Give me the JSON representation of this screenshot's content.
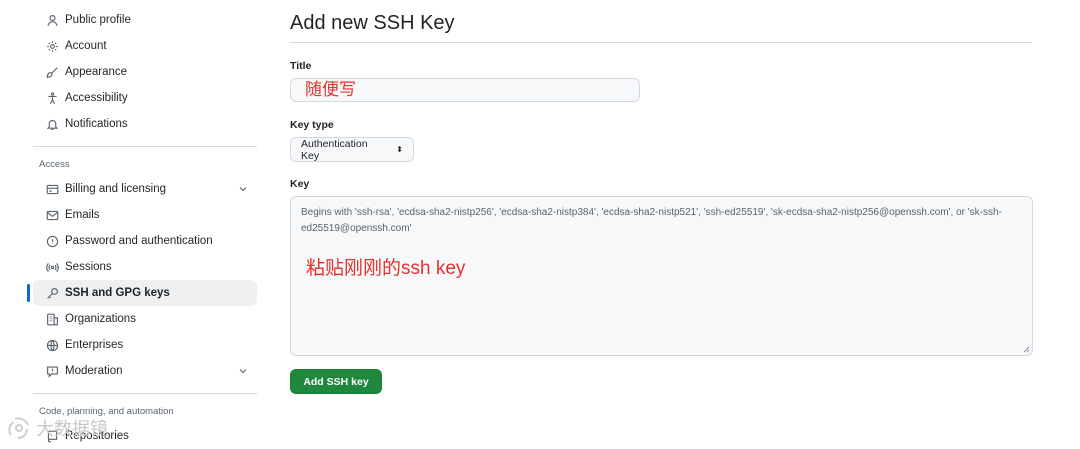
{
  "sidebar": {
    "items_top": [
      {
        "label": "Public profile",
        "icon": "person-icon"
      },
      {
        "label": "Account",
        "icon": "gear-icon"
      },
      {
        "label": "Appearance",
        "icon": "paintbrush-icon"
      },
      {
        "label": "Accessibility",
        "icon": "accessibility-icon"
      },
      {
        "label": "Notifications",
        "icon": "bell-icon"
      }
    ],
    "access_label": "Access",
    "items_access": [
      {
        "label": "Billing and licensing",
        "icon": "credit-card-icon"
      },
      {
        "label": "Emails",
        "icon": "mail-icon"
      },
      {
        "label": "Password and authentication",
        "icon": "shield-lock-icon"
      },
      {
        "label": "Sessions",
        "icon": "broadcast-icon"
      },
      {
        "label": "SSH and GPG keys",
        "icon": "key-icon"
      },
      {
        "label": "Organizations",
        "icon": "organization-icon"
      },
      {
        "label": "Enterprises",
        "icon": "globe-icon"
      },
      {
        "label": "Moderation",
        "icon": "report-icon"
      }
    ],
    "code_label": "Code, planning, and automation",
    "items_code": [
      {
        "label": "Repositories",
        "icon": "repo-icon"
      }
    ]
  },
  "main": {
    "page_title": "Add new SSH Key",
    "title_label": "Title",
    "title_value": "随便写",
    "keytype_label": "Key type",
    "keytype_selected": "Authentication Key",
    "key_label": "Key",
    "key_placeholder": "Begins with 'ssh-rsa', 'ecdsa-sha2-nistp256', 'ecdsa-sha2-nistp384', 'ecdsa-sha2-nistp521', 'ssh-ed25519', 'sk-ecdsa-sha2-nistp256@openssh.com', or 'sk-ssh-ed25519@openssh.com'",
    "key_annotation": "粘贴刚刚的ssh key",
    "submit_label": "Add SSH key"
  },
  "colors": {
    "accent": "#0969da",
    "primary_button": "#1f883d",
    "annotation": "#e5322d"
  },
  "watermark": {
    "text": "大数据镜"
  }
}
